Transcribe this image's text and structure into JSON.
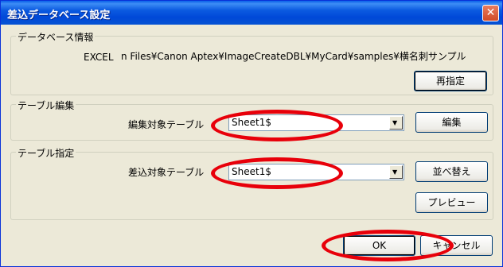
{
  "window": {
    "title": "差込データベース設定",
    "close_glyph": "✕"
  },
  "db_info": {
    "group_label": "データベース情報",
    "type_label": "EXCEL",
    "path": "n Files¥Canon Aptex¥ImageCreateDBL¥MyCard¥samples¥横名刺サンプル",
    "respecify_label": "再指定"
  },
  "table_edit": {
    "group_label": "テーブル編集",
    "field_label": "編集対象テーブル",
    "selected": "Sheet1$",
    "edit_label": "編集"
  },
  "table_spec": {
    "group_label": "テーブル指定",
    "field_label": "差込対象テーブル",
    "selected": "Sheet1$",
    "sort_label": "並べ替え",
    "preview_label": "プレビュー"
  },
  "footer": {
    "ok_label": "OK",
    "cancel_label": "キャンセル"
  },
  "colors": {
    "highlight_ellipse": "#E8000A",
    "titlebar": "#0054E3"
  }
}
